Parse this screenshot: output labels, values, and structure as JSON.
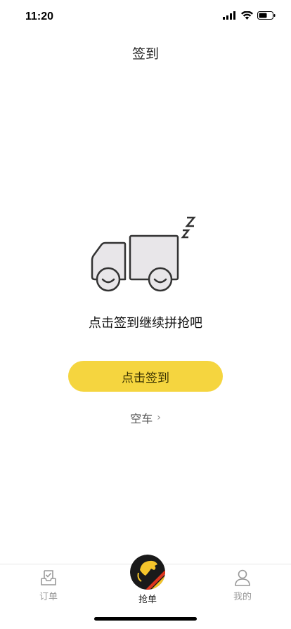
{
  "status": {
    "time": "11:20"
  },
  "nav": {
    "title": "签到"
  },
  "main": {
    "tip": "点击签到继续拼抢吧",
    "checkin_label": "点击签到",
    "empty_label": "空车",
    "chevron": "›",
    "illustration_icon": "sleeping-truck-icon"
  },
  "tabs": [
    {
      "label": "订单",
      "icon": "order-inbox-icon",
      "active": false
    },
    {
      "label": "抢单",
      "icon": "horse-logo-icon",
      "active": true
    },
    {
      "label": "我的",
      "icon": "user-icon",
      "active": false
    }
  ],
  "colors": {
    "accent": "#f5d53f",
    "truck_fill": "#e8e6e9",
    "logo_bg": "#1a1a1a",
    "logo_stripe": "#e0361f"
  }
}
